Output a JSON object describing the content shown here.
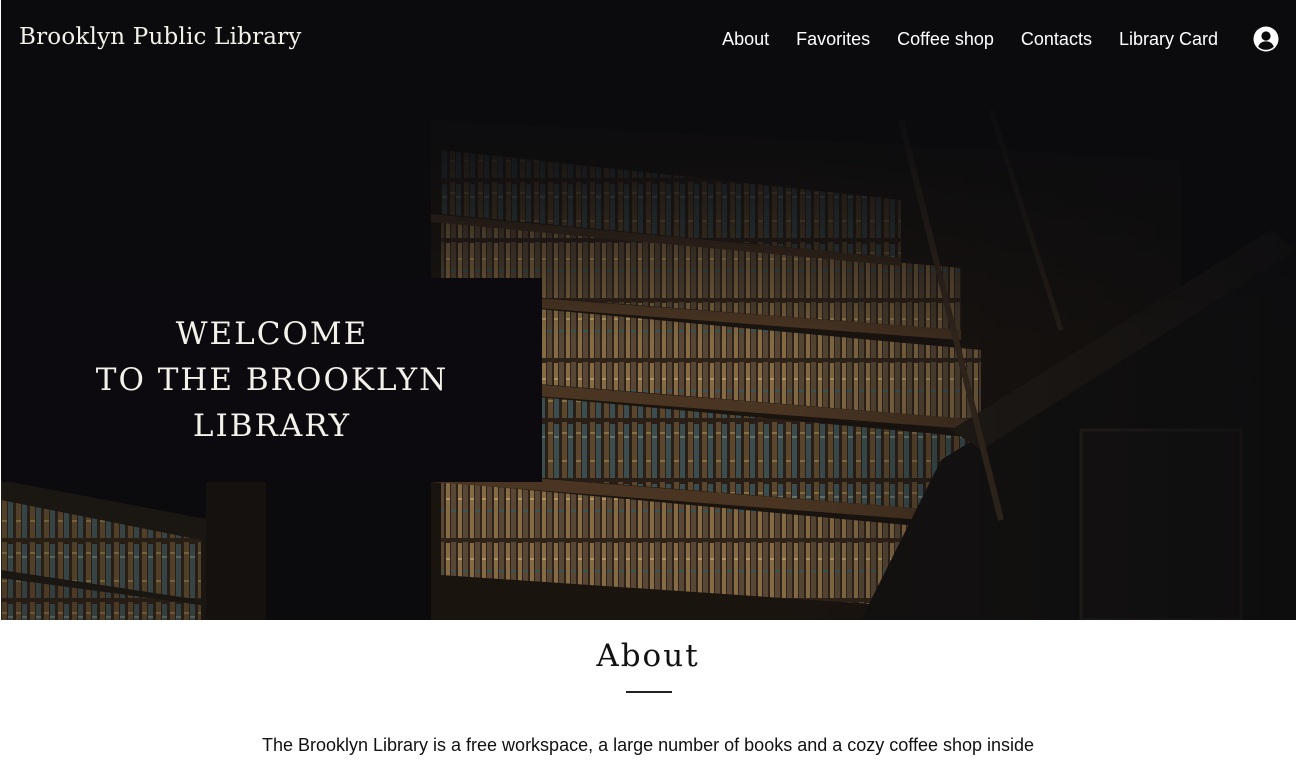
{
  "header": {
    "brand": "Brooklyn Public Library",
    "nav": [
      {
        "label": "About"
      },
      {
        "label": "Favorites"
      },
      {
        "label": "Coffee shop"
      },
      {
        "label": "Contacts"
      },
      {
        "label": "Library Card"
      }
    ],
    "profile_icon": "user-circle-icon"
  },
  "hero": {
    "welcome_lines": [
      "WELCOME",
      "TO THE BROOKLYN",
      "LIBRARY"
    ]
  },
  "about": {
    "title": "About",
    "text": "The Brooklyn Library is a free workspace, a large number of books and a cozy coffee shop inside"
  },
  "colors": {
    "background_dark": "#0b0b0e",
    "text_light": "#f4f1ea",
    "text_dark": "#111111"
  }
}
